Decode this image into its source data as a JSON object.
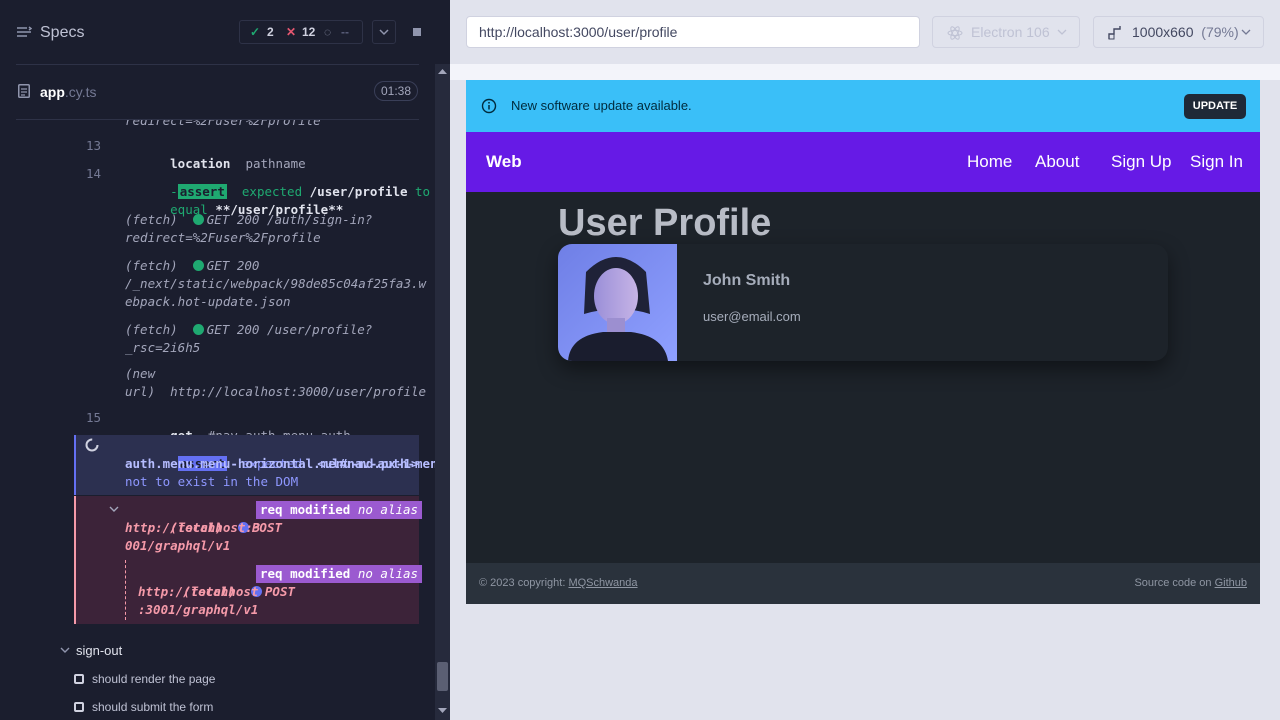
{
  "reporter": {
    "specs_title": "Specs",
    "stats": {
      "passed": "2",
      "failed": "12",
      "pending": "--"
    },
    "spec_file": {
      "name": "app",
      "ext": ".cy.ts"
    },
    "timer": "01:38",
    "commands": {
      "partial_top": "redirect=%2Fuser%2Fprofile",
      "c13_num": "13",
      "c13_name": "location",
      "c13_msg": "pathname",
      "c14_num": "14",
      "c14_dash": "-",
      "c14_name": "assert",
      "c14_msg_a": "expected",
      "c14_msg_b": "/user/profile",
      "c14_msg_c": "to",
      "c14_msg_d": "equal",
      "c14_msg_e": "**/user/profile**",
      "f1_tag": "(fetch)",
      "f1_msg_a": "GET 200 /auth/sign-in?",
      "f1_msg_b": "redirect=%2Fuser%2Fprofile",
      "f2_tag": "(fetch)",
      "f2_msg_a": "GET 200",
      "f2_msg_b": "/_next/static/webpack/98de85c04af25fa3.w",
      "f2_msg_c": "ebpack.hot-update.json",
      "f3_tag": "(fetch)",
      "f3_msg_a": "GET 200 /user/profile?",
      "f3_msg_b": "_rsc=2i6h5",
      "nu_tag_a": "(new",
      "nu_tag_b": "url)",
      "nu_msg": "http://localhost:3000/user/profile",
      "c15_num": "15",
      "c15_name": "get",
      "c15_msg": "#nav-auth-menu-auth",
      "a_dash": "-",
      "a_name": "assert",
      "a_msg_a": "expected",
      "a_msg_b": "<ul#nav-auth-menu-",
      "a_msg_c": "auth.menu.menu-horizontal.menu-md.px-1>",
      "a_msg_d": "not to exist in the DOM",
      "p1_tag": "(fetch)",
      "p1_method": "POST",
      "p1_url_a": "http://localhost:3",
      "p1_url_b": "001/graphql/v1",
      "p1_badge": "req modified",
      "p1_alias": "no alias",
      "p2_tag": "(fetch)",
      "p2_method": "POST",
      "p2_url_a": "http://localhost",
      "p2_url_b": ":3001/graphql/v1",
      "p2_badge": "req modified",
      "p2_alias": "no alias"
    },
    "suite": "sign-out",
    "tests": [
      "should render the page",
      "should submit the form"
    ]
  },
  "aut": {
    "url": "http://localhost:3000/user/profile",
    "browser": "Electron 106",
    "viewport": "1000x660",
    "scale": "(79%)"
  },
  "app": {
    "alert_text": "New software update available.",
    "update_label": "UPDATE",
    "brand": "Web",
    "nav": [
      "Home",
      "About",
      "Sign Up",
      "Sign In"
    ],
    "page_title": "User Profile",
    "user_name": "John Smith",
    "user_email": "user@email.com",
    "footer_left": "© 2023 copyright: ",
    "footer_left_link": "MQSchwanda",
    "footer_right": "Source code on ",
    "footer_right_link": "Github"
  },
  "colors": {
    "accent": "#6470f3",
    "pass": "#1fa971",
    "fail": "#f59aa9",
    "navbar": "#661ae6",
    "alert": "#3abff8"
  }
}
